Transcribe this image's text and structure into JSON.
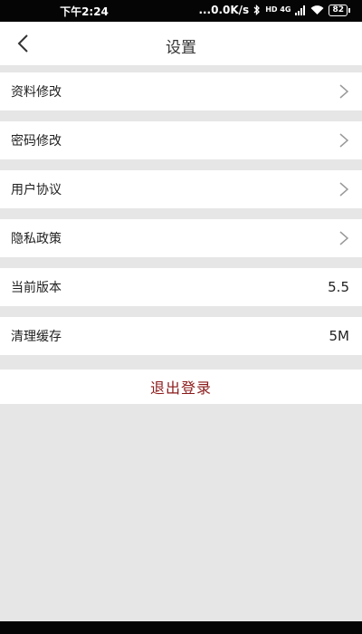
{
  "status_bar": {
    "time": "下午2:24",
    "network_speed": "...0.0K/s",
    "network_type": "HD 4G",
    "battery": "82"
  },
  "header": {
    "title": "设置"
  },
  "settings": [
    {
      "label": "资料修改",
      "chevron": true
    },
    {
      "label": "密码修改",
      "chevron": true
    },
    {
      "label": "用户协议",
      "chevron": true
    },
    {
      "label": "隐私政策",
      "chevron": true
    },
    {
      "label": "当前版本",
      "value": "5.5"
    },
    {
      "label": "清理缓存",
      "value": "5M"
    }
  ],
  "logout_label": "退出登录",
  "colors": {
    "logout_text": "#8b1a1a",
    "page_bg": "#e6e6e6"
  }
}
